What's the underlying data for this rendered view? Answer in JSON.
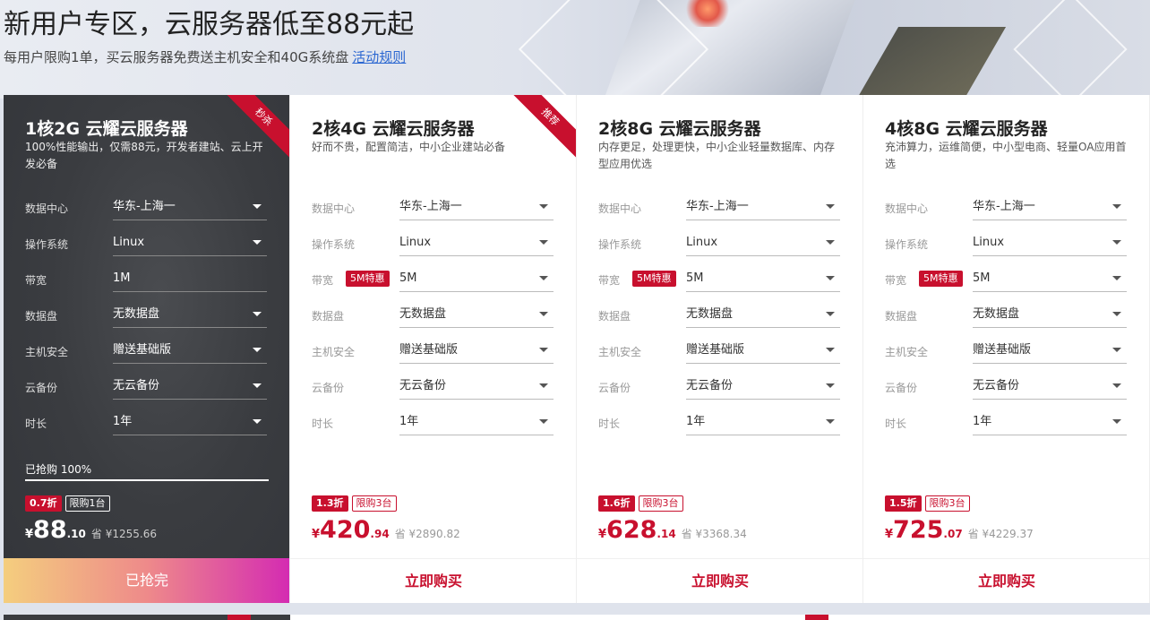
{
  "hero": {
    "title": "新用户专区，云服务器低至88元起",
    "subtitle": "每用户限购1单，买云服务器免费送主机安全和40G系统盘",
    "rules_link": "活动规则"
  },
  "labels": {
    "datacenter": "数据中心",
    "os": "操作系统",
    "bandwidth": "带宽",
    "disk": "数据盘",
    "security": "主机安全",
    "backup": "云备份",
    "duration": "时长"
  },
  "cards": [
    {
      "ribbon": "秒杀",
      "title": "1核2G 云耀云服务器",
      "desc": "100%性能输出，仅需88元，开发者建站、云上开发必备",
      "datacenter": "华东-上海一",
      "os": "Linux",
      "bandwidth_promo": "",
      "bandwidth": "1M",
      "disk": "无数据盘",
      "security": "赠送基础版",
      "backup": "无云备份",
      "duration": "1年",
      "sold_text": "已抢购 100%",
      "discount": "0.7折",
      "limit": "限购1台",
      "yen": "¥",
      "price_int": "88",
      "price_dec": ".10",
      "orig_price": "省 ¥1255.66",
      "button": "已抢完"
    },
    {
      "ribbon": "推荐",
      "title": "2核4G 云耀云服务器",
      "desc": "好而不贵，配置简洁，中小企业建站必备",
      "datacenter": "华东-上海一",
      "os": "Linux",
      "bandwidth_promo": "5M特惠",
      "bandwidth": "5M",
      "disk": "无数据盘",
      "security": "赠送基础版",
      "backup": "无云备份",
      "duration": "1年",
      "discount": "1.3折",
      "limit": "限购3台",
      "yen": "¥",
      "price_int": "420",
      "price_dec": ".94",
      "orig_price": "省 ¥2890.82",
      "button": "立即购买"
    },
    {
      "title": "2核8G 云耀云服务器",
      "desc": "内存更足，处理更快，中小企业轻量数据库、内存型应用优选",
      "datacenter": "华东-上海一",
      "os": "Linux",
      "bandwidth_promo": "5M特惠",
      "bandwidth": "5M",
      "disk": "无数据盘",
      "security": "赠送基础版",
      "backup": "无云备份",
      "duration": "1年",
      "discount": "1.6折",
      "limit": "限购3台",
      "yen": "¥",
      "price_int": "628",
      "price_dec": ".14",
      "orig_price": "省 ¥3368.34",
      "button": "立即购买"
    },
    {
      "title": "4核8G 云耀云服务器",
      "desc": "充沛算力，运维简便，中小型电商、轻量OA应用首选",
      "datacenter": "华东-上海一",
      "os": "Linux",
      "bandwidth_promo": "5M特惠",
      "bandwidth": "5M",
      "disk": "无数据盘",
      "security": "赠送基础版",
      "backup": "无云备份",
      "duration": "1年",
      "discount": "1.5折",
      "limit": "限购3台",
      "yen": "¥",
      "price_int": "725",
      "price_dec": ".07",
      "orig_price": "省 ¥4229.37",
      "button": "立即购买"
    }
  ]
}
